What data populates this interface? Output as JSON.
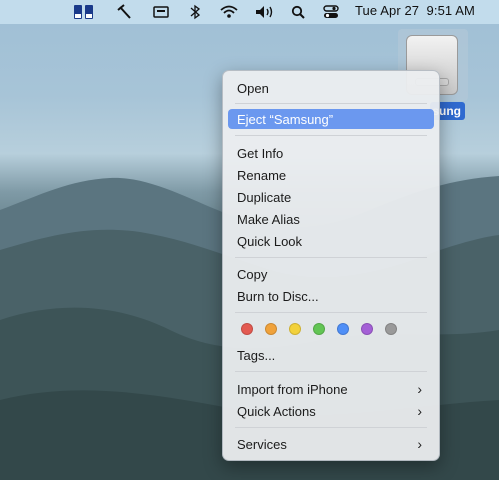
{
  "menubar": {
    "clock": "Tue Apr 27  9:51 AM"
  },
  "desktop": {
    "drive_label": "sung"
  },
  "context_menu": {
    "open": "Open",
    "eject": "Eject “Samsung”",
    "get_info": "Get Info",
    "rename": "Rename",
    "duplicate": "Duplicate",
    "make_alias": "Make Alias",
    "quick_look": "Quick Look",
    "copy": "Copy",
    "burn": "Burn to Disc...",
    "tags": "Tags...",
    "import_iphone": "Import from iPhone",
    "quick_actions": "Quick Actions",
    "services": "Services",
    "submenu_arrow": "›",
    "tag_colors": [
      "#e35a51",
      "#f0a23b",
      "#f2d13b",
      "#62c554",
      "#4f8ff7",
      "#a460d6",
      "#9a9a9a"
    ]
  }
}
